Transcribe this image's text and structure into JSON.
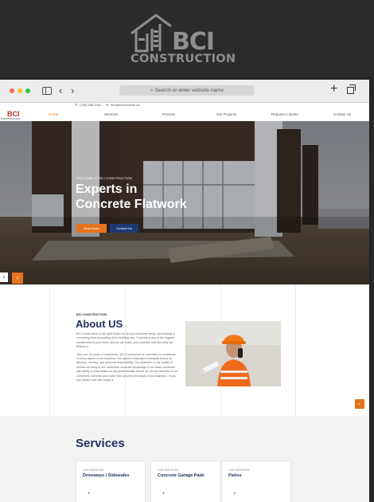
{
  "brand": {
    "logo_main": "BCI",
    "logo_sub": "CONSTRUCTION"
  },
  "browser": {
    "address_placeholder": "Search or enter website name",
    "back": "‹",
    "forward": "›",
    "new_tab": "+"
  },
  "site": {
    "topbar": {
      "phone": "(780) 288-1081",
      "email": "info@bciconcrete.ca"
    },
    "logo": {
      "main": "BCI",
      "sub": "CONSTRUCTION LTD"
    },
    "nav": [
      "Home",
      "Services",
      "Process",
      "Our Projects",
      "Request A Quote",
      "Contact Us"
    ],
    "nav_active": "Home",
    "hero": {
      "label": "WELCOME TO BCI CONSTRUCTION",
      "title_line1": "Experts in",
      "title_line2": "Concrete Flatwork",
      "read_more": "Read More",
      "contact_us": "Contact Us",
      "prev": "‹",
      "next": "›"
    },
    "about": {
      "label": "BCI CONSTRUCTION",
      "title": "About US",
      "para1": "BCI Construction is the right choice for all your concrete needs, specializing in everything from renovating old to building new. Concrete is one of the biggest investments in your home and we can make your concrete look like what we believe in.",
      "para2": "With over 20 years of experience, BCI Construction is committed to excellence in every aspect of our business. We uphold a standard of integrity bound by fairness, honesty, and personal responsibility. Our distinction is the quality of service we bring to our customers. Accurate knowledge of our trade combined with ability is what makes us top professionals. Above all, we are watchful of our customers' interests and make their concerns the basis of our business - if you can dream it we can create it.",
      "scroll_up": "›"
    },
    "services": {
      "title": "Services",
      "cards": [
        {
          "label": "OUR SERVICES",
          "title": "Driveways / Sidewalks",
          "plus": "+"
        },
        {
          "label": "OUR SERVICES",
          "title": "Concrete Garage Pads",
          "plus": "+"
        },
        {
          "label": "OUR SERVICES",
          "title": "Patios",
          "plus": "+"
        }
      ]
    }
  },
  "colors": {
    "accent": "#e8731e",
    "navy": "#1e2f5e",
    "background": "#2b2b2b",
    "logo_gray": "#8f8f8f"
  },
  "icons": [
    "building-logo-icon",
    "search-icon",
    "sidebar-icon",
    "phone-icon",
    "email-icon",
    "tabs-icon"
  ]
}
